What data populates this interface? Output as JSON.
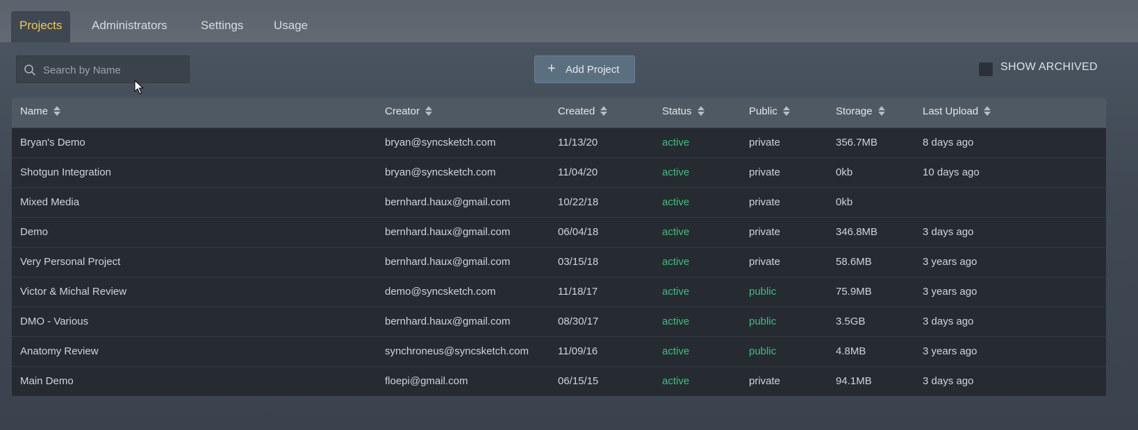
{
  "tabs": [
    {
      "label": "Projects",
      "active": true
    },
    {
      "label": "Administrators",
      "active": false
    },
    {
      "label": "Settings",
      "active": false
    },
    {
      "label": "Usage",
      "active": false
    }
  ],
  "search": {
    "placeholder": "Search by Name",
    "value": "",
    "icon": "search-icon"
  },
  "toolbar": {
    "add_label": "Add Project",
    "add_icon": "plus-icon",
    "show_archived_label": "SHOW ARCHIVED",
    "show_archived_checked": false
  },
  "table": {
    "columns": [
      "Name",
      "Creator",
      "Created",
      "Status",
      "Public",
      "Storage",
      "Last Upload"
    ],
    "rows": [
      {
        "name": "Bryan's Demo",
        "creator": "bryan@syncsketch.com",
        "created": "11/13/20",
        "status": "active",
        "public": "private",
        "storage": "356.7MB",
        "last_upload": "8 days ago"
      },
      {
        "name": "Shotgun Integration",
        "creator": "bryan@syncsketch.com",
        "created": "11/04/20",
        "status": "active",
        "public": "private",
        "storage": "0kb",
        "last_upload": "10 days ago"
      },
      {
        "name": "Mixed Media",
        "creator": "bernhard.haux@gmail.com",
        "created": "10/22/18",
        "status": "active",
        "public": "private",
        "storage": "0kb",
        "last_upload": ""
      },
      {
        "name": "Demo",
        "creator": "bernhard.haux@gmail.com",
        "created": "06/04/18",
        "status": "active",
        "public": "private",
        "storage": "346.8MB",
        "last_upload": "3 days ago"
      },
      {
        "name": "Very Personal Project",
        "creator": "bernhard.haux@gmail.com",
        "created": "03/15/18",
        "status": "active",
        "public": "private",
        "storage": "58.6MB",
        "last_upload": "3 years ago"
      },
      {
        "name": "Victor & Michal Review",
        "creator": "demo@syncsketch.com",
        "created": "11/18/17",
        "status": "active",
        "public": "public",
        "storage": "75.9MB",
        "last_upload": "3 years ago"
      },
      {
        "name": "DMO - Various",
        "creator": "bernhard.haux@gmail.com",
        "created": "08/30/17",
        "status": "active",
        "public": "public",
        "storage": "3.5GB",
        "last_upload": "3 days ago"
      },
      {
        "name": "Anatomy Review",
        "creator": "synchroneus@syncsketch.com",
        "created": "11/09/16",
        "status": "active",
        "public": "public",
        "storage": "4.8MB",
        "last_upload": "3 years ago"
      },
      {
        "name": "Main Demo",
        "creator": "floepi@gmail.com",
        "created": "06/15/15",
        "status": "active",
        "public": "private",
        "storage": "94.1MB",
        "last_upload": "3 days ago"
      }
    ]
  },
  "colors": {
    "active_tab": "#f2c94c",
    "status_green": "#3dbf7d",
    "header_bg": "#4f5964",
    "row_bg": "#252b31"
  }
}
